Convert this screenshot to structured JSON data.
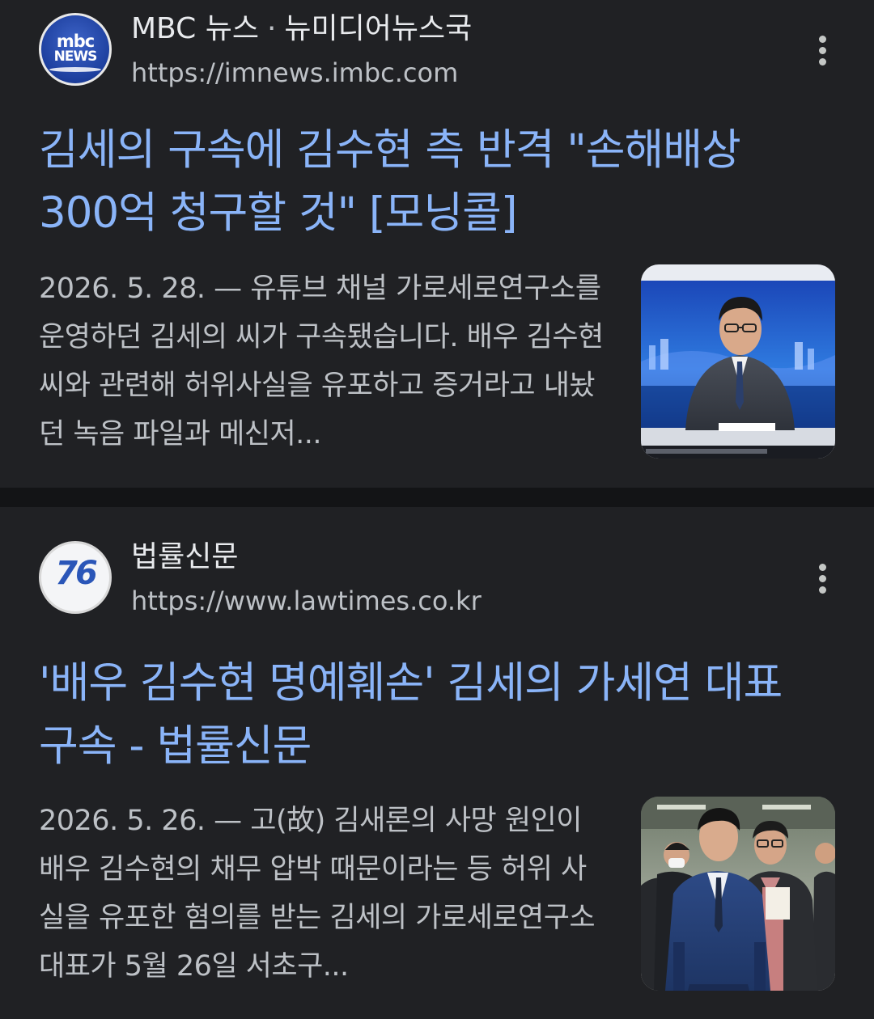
{
  "results": [
    {
      "source_name": "MBC 뉴스",
      "source_separator": "·",
      "source_section": "뉴미디어뉴스국",
      "url": "https://imnews.imbc.com",
      "logo_text_top": "mbc",
      "logo_text_bottom": "NEWS",
      "headline": "김세의 구속에 김수현 측 반격 \"손해배상 300억 청구할 것\" [모닝콜]",
      "snippet": "2026. 5. 28. — 유튜브 채널 가로세로연구소를 운영하던 김세의 씨가 구속됐습니다. 배우 김수현 씨와 관련해 허위사실을 유포하고 증거라고 내놨던 녹음 파일과 메신저...",
      "thumbnail": "news-anchor-photo"
    },
    {
      "source_name": "법률신문",
      "url": "https://www.lawtimes.co.kr",
      "logo_text": "76",
      "headline": "'배우 김수현 명예훼손' 김세의 가세연 대표 구속 - 법률신문",
      "snippet": "2026. 5. 26. — 고(故) 김새론의 사망 원인이 배우 김수현의 채무 압박 때문이라는 등 허위 사실을 유포한 혐의를 받는 김세의 가로세로연구소 대표가 5월 26일 서초구...",
      "thumbnail": "court-arrival-photo"
    }
  ],
  "colors": {
    "background": "#202124",
    "divider": "#131416",
    "headline": "#8ab4f8",
    "source_name": "#e8eaed",
    "secondary_text": "#bdc1c6"
  },
  "icons": {
    "more": "more-vert-icon"
  }
}
